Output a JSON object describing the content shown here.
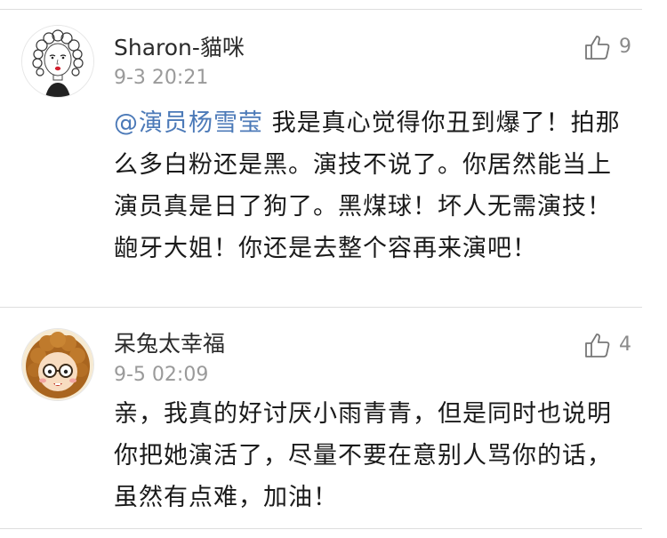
{
  "comments": [
    {
      "username": "Sharon-貓咪",
      "timestamp": "9-3 20:21",
      "likes": "9",
      "mention": "@演员杨雪莹",
      "text": " 我是真心觉得你丑到爆了！拍那么多白粉还是黑。演技不说了。你居然能当上演员真是日了狗了。黑煤球！坏人无需演技！龅牙大姐！你还是去整个容再来演吧！",
      "avatar_icon": "sketch-woman-avatar"
    },
    {
      "username": "呆兔太幸福",
      "timestamp": "9-5 02:09",
      "likes": "4",
      "text": "亲，我真的好讨厌小雨青青，但是同时也说明你把她演活了，尽量不要在意别人骂你的话，虽然有点难，加油！",
      "avatar_icon": "cartoon-girl-avatar"
    }
  ],
  "colors": {
    "mention": "#4c7ab8",
    "timestamp": "#9a9a9a",
    "divider": "#dedede"
  }
}
